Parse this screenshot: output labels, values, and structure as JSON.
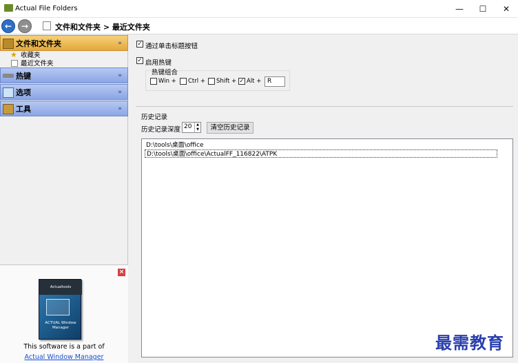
{
  "window": {
    "title": "Actual File Folders",
    "controls": {
      "minimize": "—",
      "maximize": "☐",
      "close": "✕"
    }
  },
  "toolbar": {
    "back_icon": "back-arrow-icon",
    "forward_icon": "forward-arrow-icon",
    "breadcrumb": "文件和文件夹 > 最近文件夹"
  },
  "sidebar": {
    "groups": [
      {
        "label": "文件和文件夹",
        "icon": "folder-icon",
        "expanded": true,
        "chevron": "«"
      },
      {
        "label": "热键",
        "icon": "keyboard-icon",
        "expanded": false,
        "chevron": "»"
      },
      {
        "label": "选项",
        "icon": "options-icon",
        "expanded": false,
        "chevron": "»"
      },
      {
        "label": "工具",
        "icon": "tools-icon",
        "expanded": false,
        "chevron": "»"
      }
    ],
    "subitems": [
      {
        "label": "收藏夹",
        "icon": "star-icon"
      },
      {
        "label": "最近文件夹",
        "icon": "recent-folder-icon"
      }
    ]
  },
  "ad": {
    "close": "×",
    "brand": "Actualtools",
    "product_name": "ACTUAL Window Manager",
    "text": "This software is a part of",
    "link": "Actual Window Manager"
  },
  "settings": {
    "pass_title_buttons": {
      "label": "通过单击标题按钮",
      "checked": true
    },
    "enable_hotkey": {
      "label": "启用热键",
      "checked": true
    },
    "hotkey_combo_label": "热键组合",
    "modifiers": [
      {
        "label": "Win +",
        "checked": false
      },
      {
        "label": "Ctrl +",
        "checked": false
      },
      {
        "label": "Shift +",
        "checked": false
      },
      {
        "label": "Alt +",
        "checked": true
      }
    ],
    "key_value": "R"
  },
  "history": {
    "section_title": "历史记录",
    "depth_label": "历史记录深度",
    "depth_value": "20",
    "clear_button": "清空历史记录",
    "items": [
      "D:\\tools\\桌面\\office",
      "D:\\tools\\桌面\\office\\ActualFF_116822\\ATPK"
    ]
  },
  "watermark": "最需教育",
  "colors": {
    "group_active": "#e5a83a",
    "group_inactive": "#8ba6e4",
    "link": "#1a4fd0",
    "watermark": "#2a3fae"
  }
}
